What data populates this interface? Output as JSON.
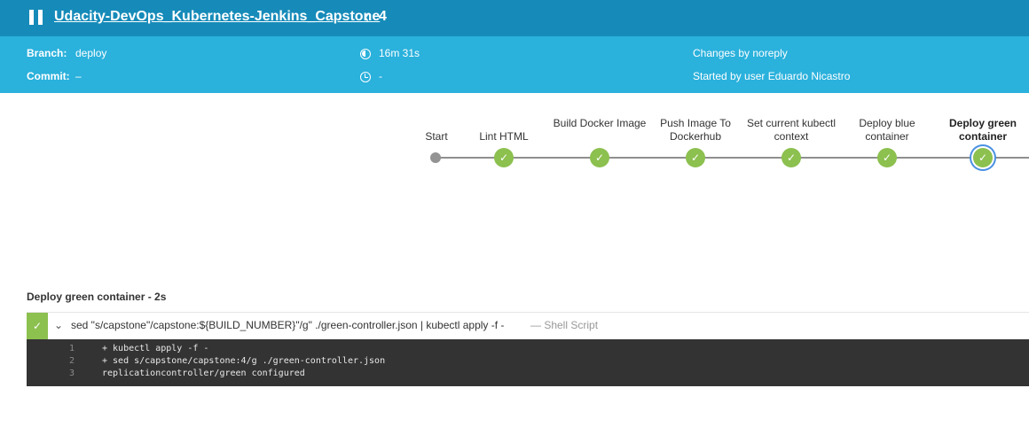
{
  "header": {
    "title": "Udacity-DevOps_Kubernetes-Jenkins_Capstone",
    "back_glyph": "‹",
    "run_number": "4",
    "icons": [
      "pause-icon",
      "back-icon"
    ]
  },
  "meta": {
    "branch_label": "Branch:",
    "branch_value": "deploy",
    "commit_label": "Commit:",
    "commit_value": "–",
    "duration": "16m 31s",
    "end_time": "-",
    "changes": "Changes by noreply",
    "started_by": "Started by user Eduardo Nicastro",
    "icons": [
      "duration-icon",
      "clock-icon"
    ]
  },
  "pipeline": {
    "stages": [
      {
        "label": "Start",
        "status": "none"
      },
      {
        "label": "Lint HTML",
        "status": "success"
      },
      {
        "label": "Build Docker Image",
        "status": "success"
      },
      {
        "label": "Push Image To Dockerhub",
        "status": "success"
      },
      {
        "label": "Set current kubectl context",
        "status": "success"
      },
      {
        "label": "Deploy blue container",
        "status": "success"
      },
      {
        "label": "Deploy green container",
        "status": "success",
        "selected": true
      }
    ],
    "check_glyph": "✓",
    "colors": {
      "success": "#8cc04f",
      "selected_ring": "#4a90e2",
      "line": "#8f8f8f"
    }
  },
  "step_panel": {
    "title": "Deploy green container - 2s",
    "status_glyph": "✓",
    "chevron_glyph": "⌄",
    "command": "sed \"s/capstone\"/capstone:${BUILD_NUMBER}\"/g\" ./green-controller.json | kubectl apply -f -",
    "type": "— Shell Script",
    "log": [
      {
        "n": "1",
        "text": "+ kubectl apply -f -"
      },
      {
        "n": "2",
        "text": "+ sed s/capstone/capstone:4/g ./green-controller.json"
      },
      {
        "n": "3",
        "text": "replicationcontroller/green configured"
      }
    ]
  },
  "colors": {
    "topbar": "#168bb9",
    "metabar": "#2ab1dc",
    "log_bg": "#333333"
  }
}
